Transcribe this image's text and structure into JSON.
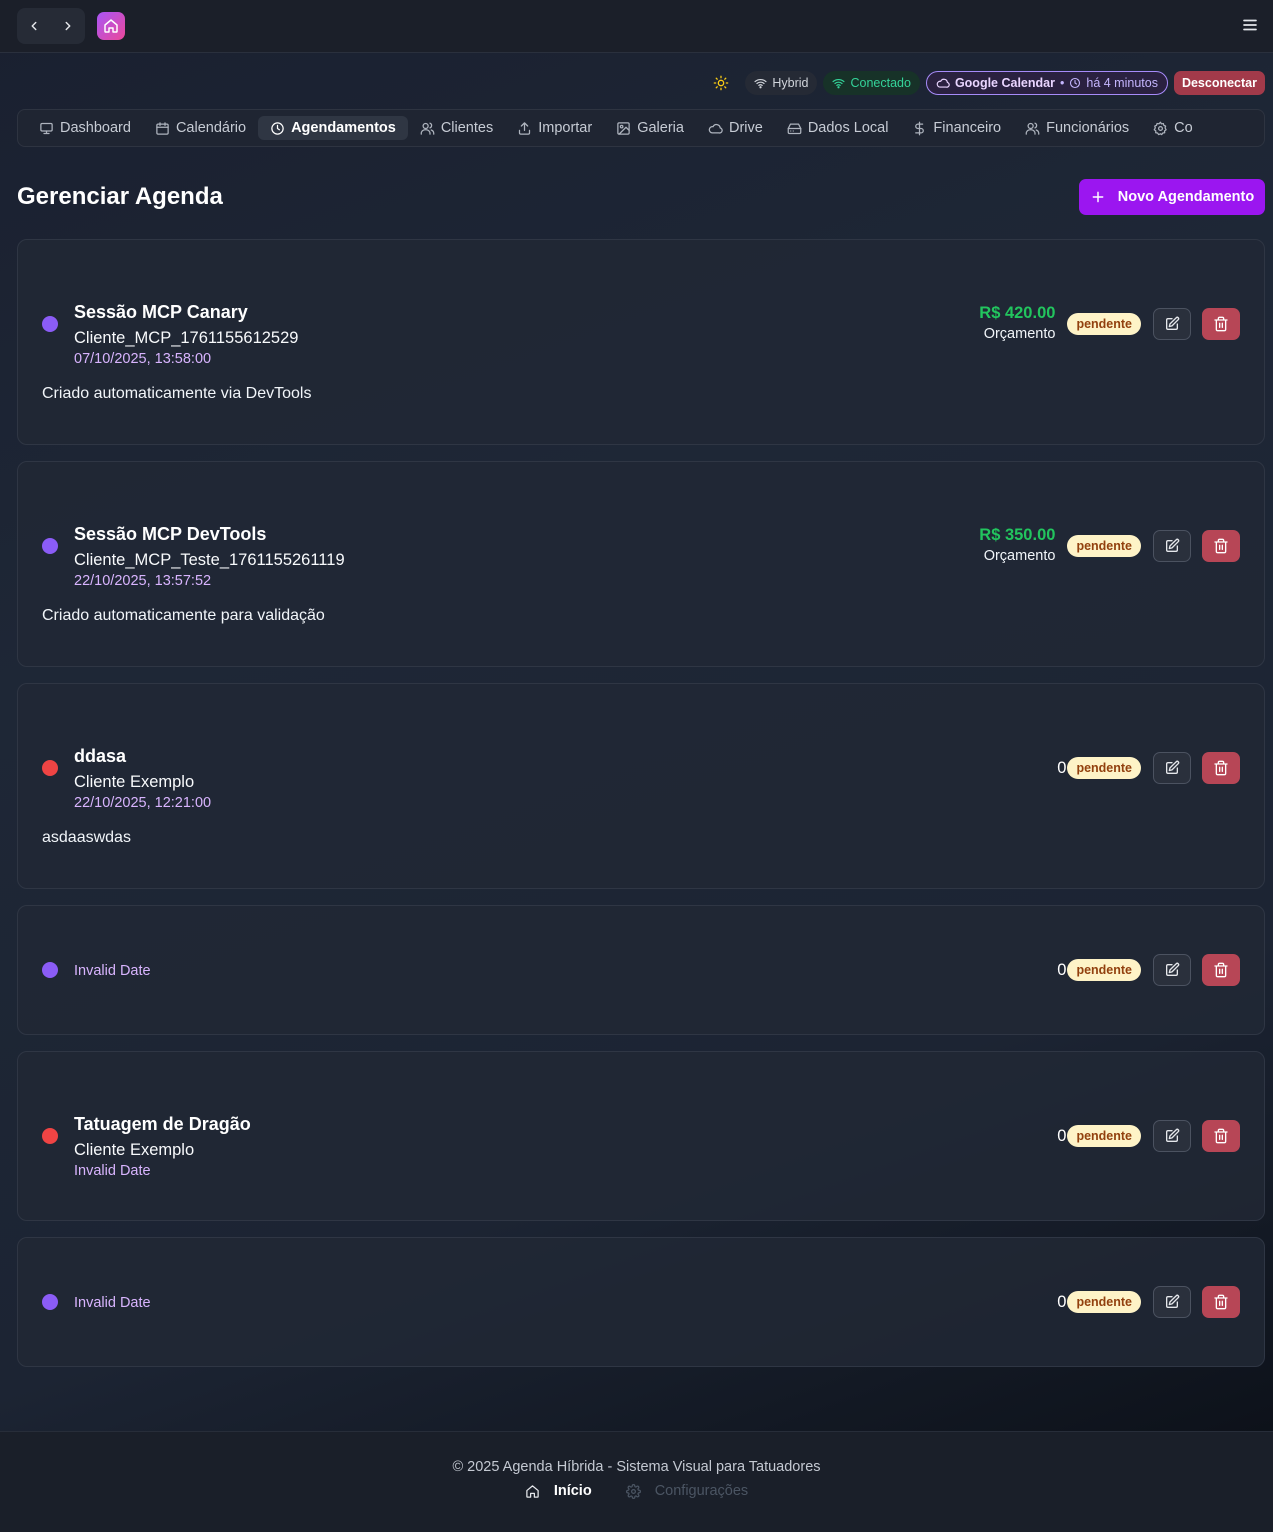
{
  "header": {
    "back_icon": "chevron-left-icon",
    "forward_icon": "chevron-right-icon",
    "logo_icon": "home-icon",
    "menu_icon": "hamburger-menu-icon"
  },
  "status": {
    "theme_icon": "sun-icon",
    "mode": "Hybrid",
    "connection": "Conectado",
    "calendar_name": "Google Calendar",
    "calendar_separator": "•",
    "calendar_sync": "há 4 minutos",
    "disconnect": "Desconectar"
  },
  "tabs": [
    {
      "label": "Dashboard",
      "icon": "monitor-icon",
      "active": false
    },
    {
      "label": "Calendário",
      "icon": "calendar-icon",
      "active": false
    },
    {
      "label": "Agendamentos",
      "icon": "clock-icon",
      "active": true
    },
    {
      "label": "Clientes",
      "icon": "users-icon",
      "active": false
    },
    {
      "label": "Importar",
      "icon": "upload-icon",
      "active": false
    },
    {
      "label": "Galeria",
      "icon": "image-icon",
      "active": false
    },
    {
      "label": "Drive",
      "icon": "cloud-icon",
      "active": false
    },
    {
      "label": "Dados Local",
      "icon": "hard-drive-icon",
      "active": false
    },
    {
      "label": "Financeiro",
      "icon": "dollar-icon",
      "active": false
    },
    {
      "label": "Funcionários",
      "icon": "users-icon",
      "active": false
    },
    {
      "label": "Co",
      "icon": "gear-icon",
      "active": false
    }
  ],
  "page": {
    "title": "Gerenciar Agenda",
    "new_button": "Novo Agendamento"
  },
  "appointments": [
    {
      "title": "Sessão MCP Canary",
      "client": "Cliente_MCP_1761155612529",
      "date": "07/10/2025, 13:58:00",
      "description": "Criado automaticamente via DevTools",
      "price": "R$ 420.00",
      "price_label": "Orçamento",
      "status": "pendente",
      "dot_color": "#8b5cf6"
    },
    {
      "title": "Sessão MCP DevTools",
      "client": "Cliente_MCP_Teste_1761155261119",
      "date": "22/10/2025, 13:57:52",
      "description": "Criado automaticamente para validação",
      "price": "R$ 350.00",
      "price_label": "Orçamento",
      "status": "pendente",
      "dot_color": "#8b5cf6"
    },
    {
      "title": "ddasa",
      "client": "Cliente Exemplo",
      "date": "22/10/2025, 12:21:00",
      "description": "asdaaswdas",
      "amount": "0",
      "status": "pendente",
      "dot_color": "#ef4444"
    },
    {
      "date": "Invalid Date",
      "amount": "0",
      "status": "pendente",
      "dot_color": "#8b5cf6"
    },
    {
      "title": "Tatuagem de Dragão",
      "client": "Cliente Exemplo",
      "date": "Invalid Date",
      "amount": "0",
      "status": "pendente",
      "dot_color": "#ef4444"
    },
    {
      "date": "Invalid Date",
      "amount": "0",
      "status": "pendente",
      "dot_color": "#8b5cf6"
    }
  ],
  "footer": {
    "copyright": "© 2025 Agenda Híbrida - Sistema Visual para Tatuadores",
    "home": "Início",
    "settings": "Configurações"
  }
}
